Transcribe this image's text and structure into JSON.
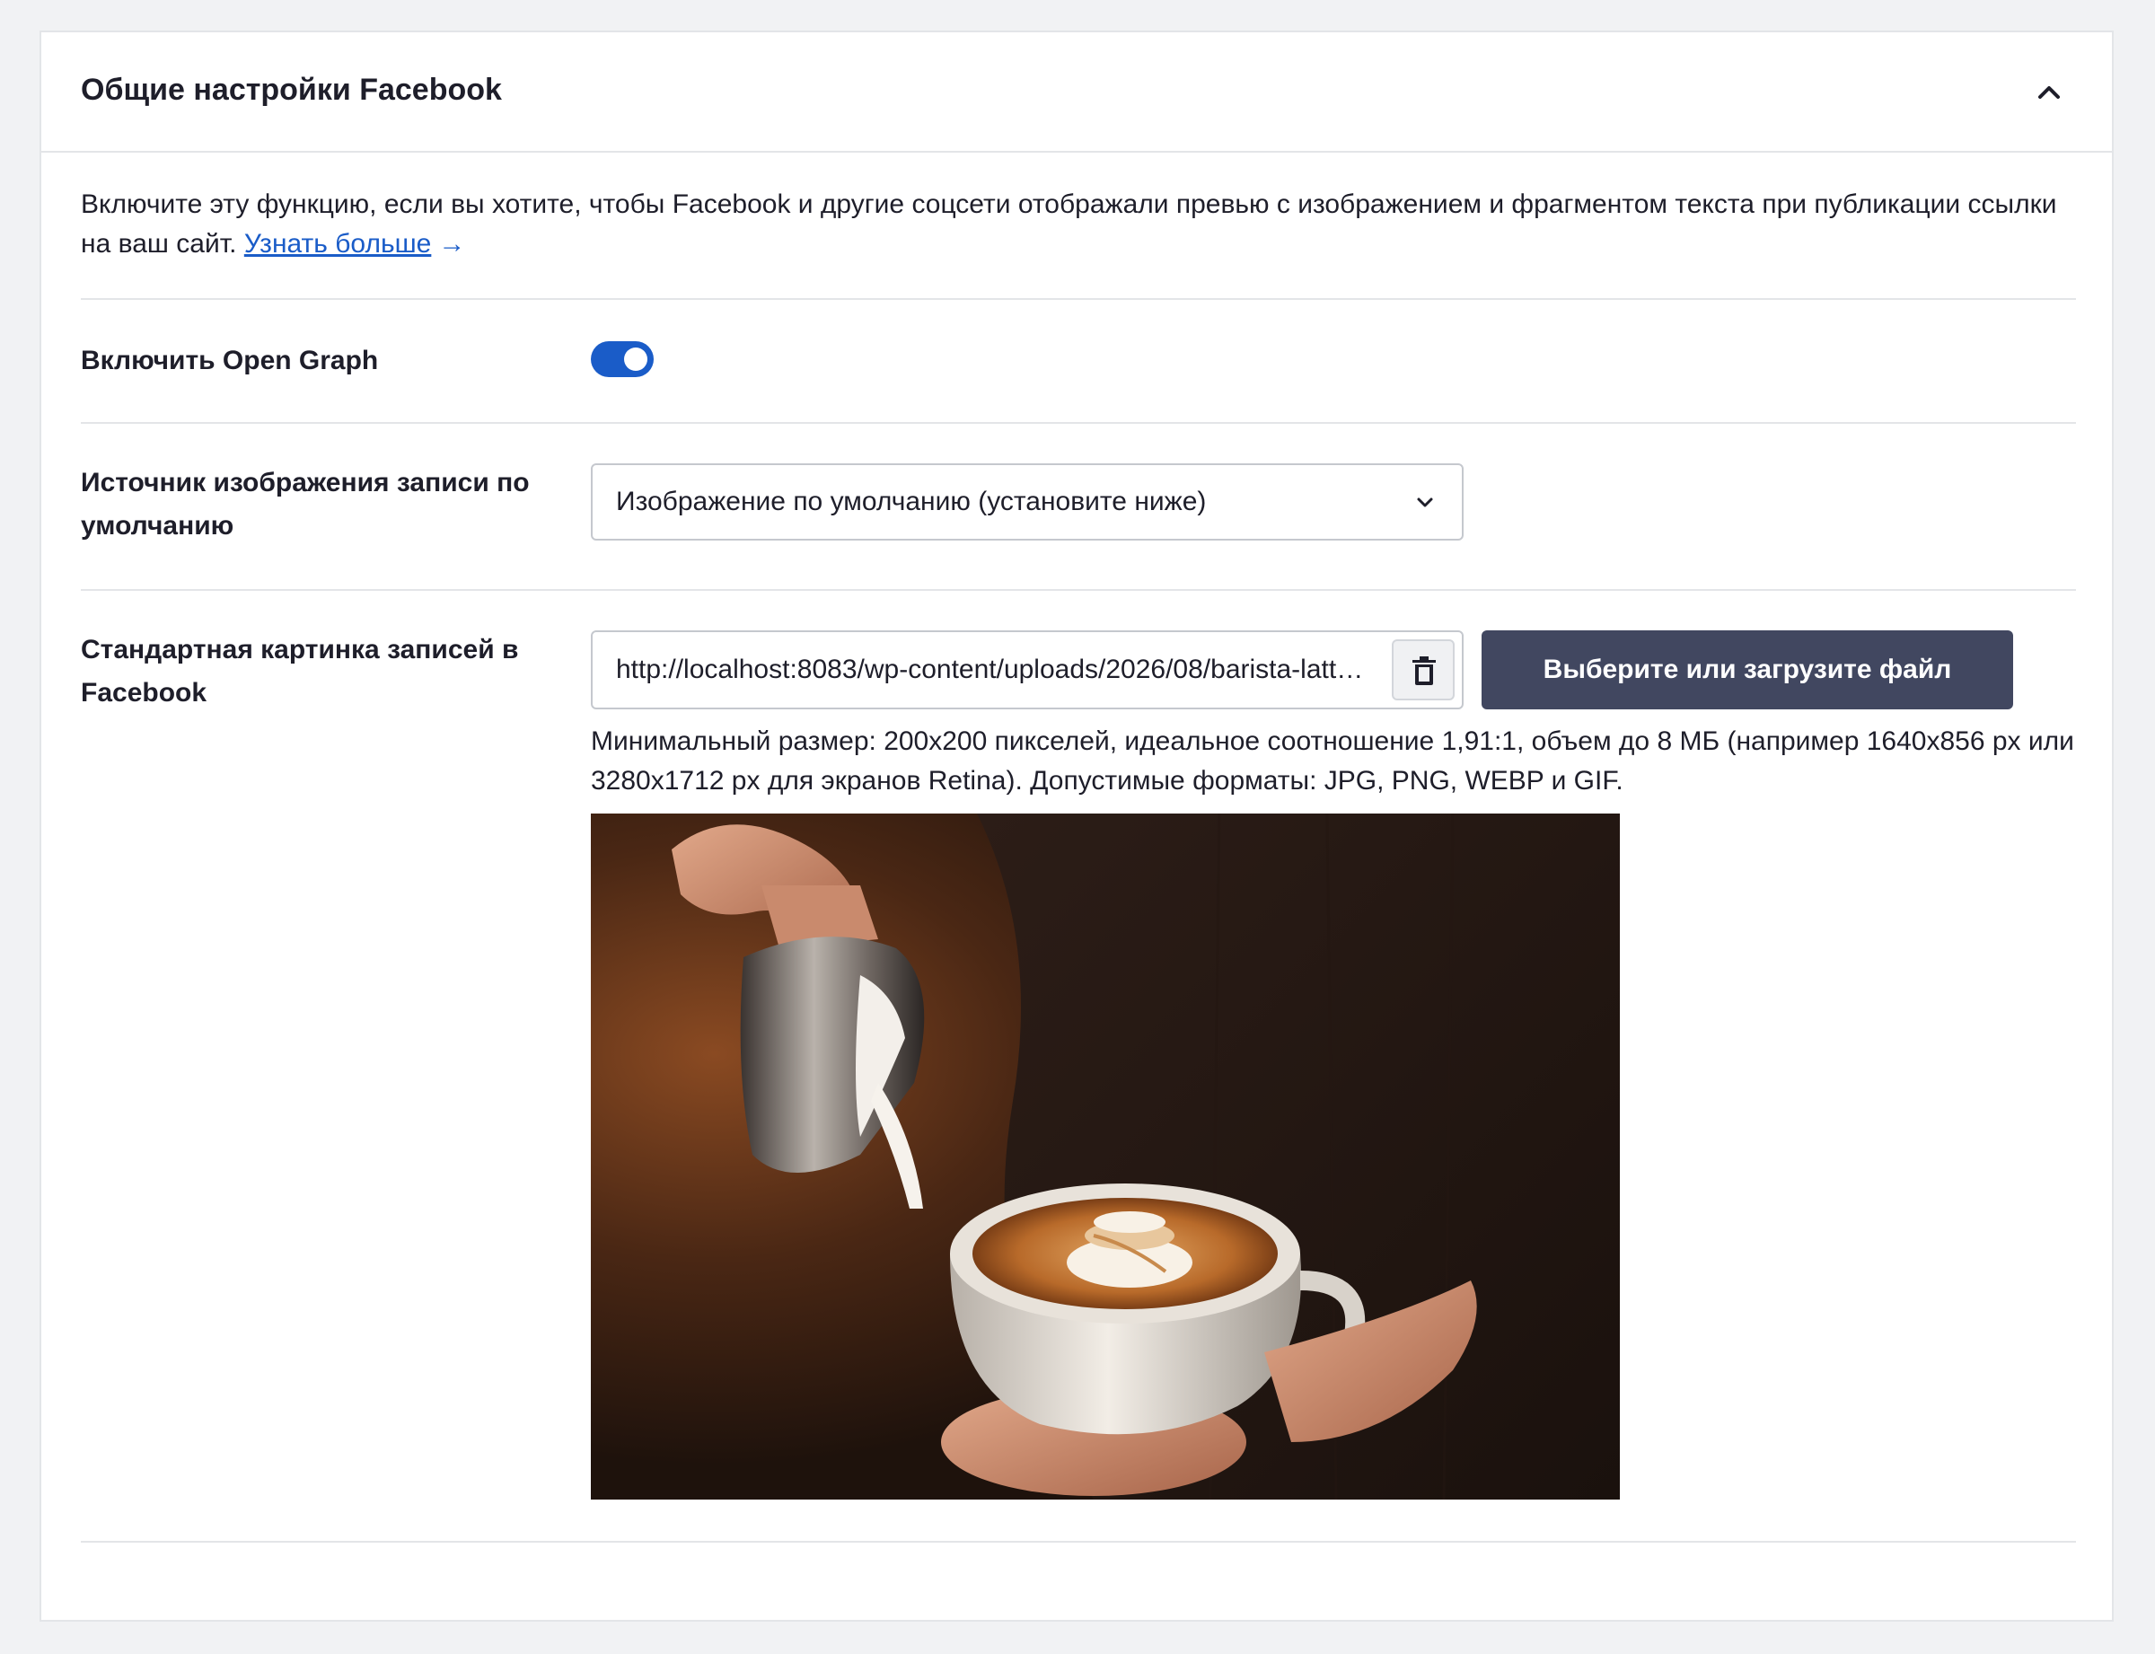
{
  "panel": {
    "title": "Общие настройки Facebook",
    "collapse_icon": "chevron-up-icon"
  },
  "intro": {
    "text": "Включите эту функцию, если вы хотите, чтобы Facebook и другие соцсети отображали превью с изображением и фрагментом текста при публикации ссылки на ваш сайт.",
    "link_text": "Узнать больше",
    "link_arrow": "→"
  },
  "open_graph": {
    "label": "Включить Open Graph",
    "enabled": true
  },
  "image_source": {
    "label": "Источник изображения записи по умолчанию",
    "selected": "Изображение по умолчанию (установите ниже)",
    "chevron_icon": "chevron-down-icon"
  },
  "default_image": {
    "label": "Стандартная картинка записей в Facebook",
    "url": "http://localhost:8083/wp-content/uploads/2026/08/barista-latte-art.jpg",
    "remove_icon": "trash-icon",
    "upload_button": "Выберите или загрузите файл",
    "help": "Минимальный размер: 200x200 пикселей, идеальное соотношение 1,91:1, объем до 8 МБ (например 1640x856 px или 3280x1712 px для экранов Retina). Допустимые форматы: JPG, PNG, WEBP и GIF.",
    "preview_alt": "barista-latte-art"
  },
  "colors": {
    "accent": "#1a5cc8",
    "button_dark": "#414760",
    "border": "#e3e5e8",
    "background": "#f1f2f4"
  }
}
